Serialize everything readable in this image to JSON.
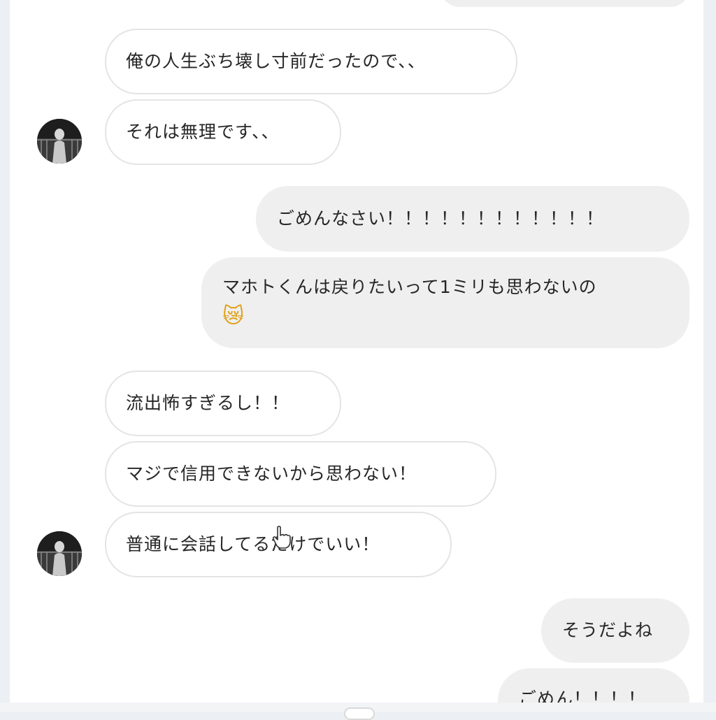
{
  "messages": {
    "in_1": "俺の人生ぶち壊し寸前だったので、、",
    "in_2": "それは無理です、、",
    "out_1": "ごめんなさい！！！！！！！！！！！！",
    "out_2_line1": "マホトくんは戻りたいって1ミリも思わないの",
    "out_2_emoji": "😿",
    "in_3": "流出怖すぎるし！！",
    "in_4": "マジで信用できないから思わない！",
    "in_5": "普通に会話してるだけでいい！",
    "out_3": "そうだよね",
    "out_4": "ごめん！！！！"
  },
  "icons": {
    "avatar": "contact-avatar",
    "cursor": "hand-pointer-icon",
    "emoji": "crying-cat-emoji"
  },
  "colors": {
    "incoming_bg": "#ffffff",
    "incoming_border": "#e4e4e4",
    "outgoing_bg": "#efefef",
    "text": "#262626"
  }
}
